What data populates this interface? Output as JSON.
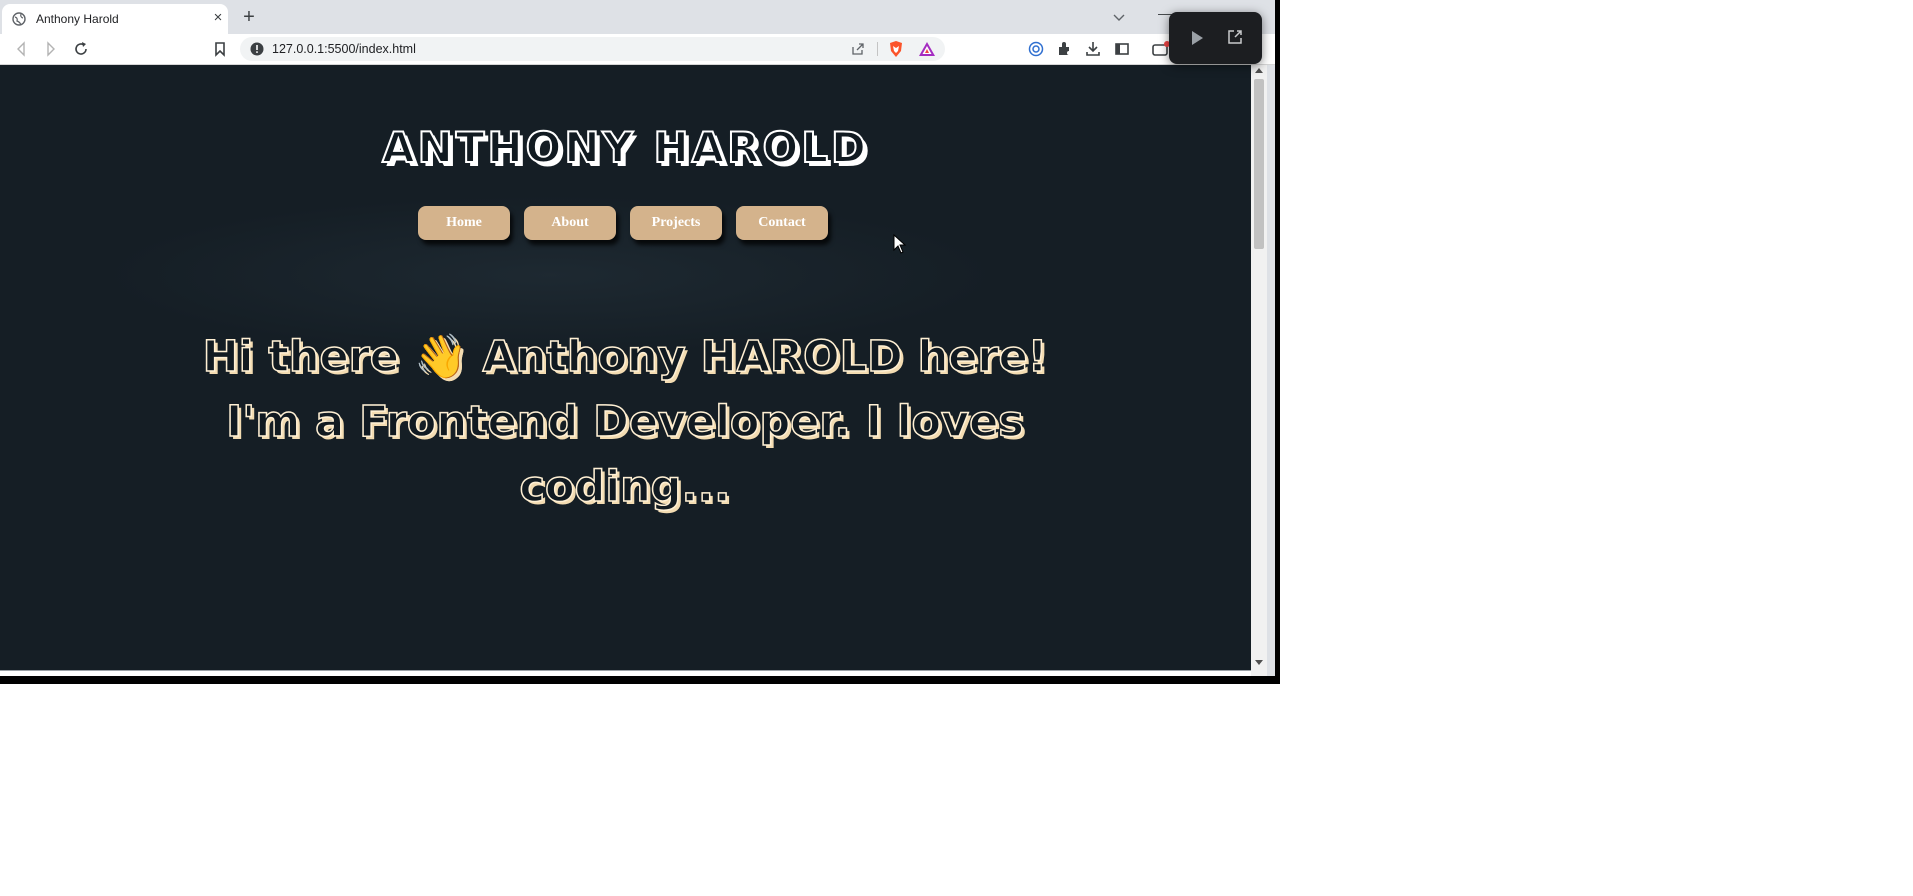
{
  "browser": {
    "tab": {
      "title": "Anthony Harold",
      "close": "×"
    },
    "new_tab": "+",
    "window_min": "—",
    "address_bar": {
      "url": "127.0.0.1:5500/index.html"
    }
  },
  "page": {
    "site_title": "ANTHONY HAROLD",
    "nav": [
      "Home",
      "About",
      "Projects",
      "Contact"
    ],
    "hero_lines": [
      "Hi there 👋 Anthony HAROLD here!",
      "I'm a Frontend Developer. I loves",
      "coding..."
    ]
  },
  "colors": {
    "page_background": "#151e25",
    "nav_button": "#d4b38c",
    "hero_outline": "#fff0d4",
    "overlay_background": "#1c1e21"
  },
  "icons": [
    "globe-icon",
    "back-icon",
    "forward-icon",
    "reload-icon",
    "bookmark-icon",
    "info-icon",
    "share-icon",
    "brave-shield-icon",
    "brave-rewards-icon",
    "vpn-icon",
    "extensions-icon",
    "download-icon",
    "sidebar-icon",
    "wallet-icon",
    "play-icon",
    "popout-icon",
    "mouse-cursor-icon"
  ]
}
